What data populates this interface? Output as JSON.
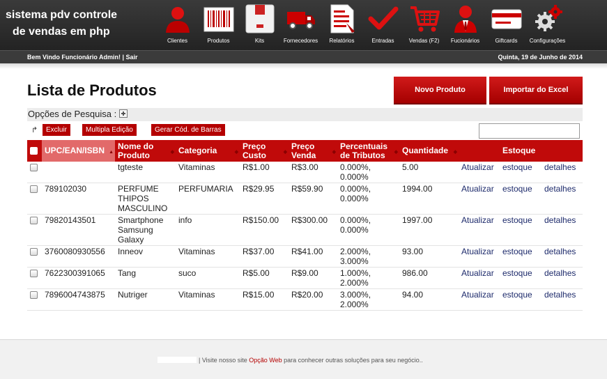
{
  "brand": {
    "line1": "sistema  pdv controle",
    "line2": "de vendas em php"
  },
  "nav": [
    {
      "label": "Clientes",
      "icon": "user-icon"
    },
    {
      "label": "Produtos",
      "icon": "barcode-icon"
    },
    {
      "label": "Kits",
      "icon": "box-icon"
    },
    {
      "label": "Fornecedores",
      "icon": "truck-icon"
    },
    {
      "label": "Relatórios",
      "icon": "report-icon"
    },
    {
      "label": "Entradas",
      "icon": "check-icon"
    },
    {
      "label": "Vendas (F2)",
      "icon": "cart-icon"
    },
    {
      "label": "Fucionários",
      "icon": "employee-icon"
    },
    {
      "label": "Giftcards",
      "icon": "giftcard-icon"
    },
    {
      "label": "Configurações",
      "icon": "gear-icon"
    }
  ],
  "welcome": {
    "text": "Bem Vindo Funcionário Admin! | Sair",
    "date": "Quinta, 19 de Junho de 2014"
  },
  "page": {
    "title": "Lista de Produtos",
    "new_product": "Novo Produto",
    "import_excel": "Importar do Excel"
  },
  "search": {
    "label": "Opções de Pesquisa :"
  },
  "actions": {
    "delete": "Excluir",
    "multi_edit": "Multipla Edição",
    "barcodes": "Gerar Cód. de Barras"
  },
  "table": {
    "headers": [
      "UPC/EAN/ISBN",
      "Nome do Produto",
      "Categoria",
      "Preço Custo",
      "Preço Venda",
      "Percentuais de Tributos",
      "Quantidade",
      "Estoque"
    ],
    "rows": [
      {
        "upc": "",
        "name": "tgteste",
        "category": "Vitaminas",
        "cost": "R$1.00",
        "price": "R$3.00",
        "taxes": "0.000%, 0.000%",
        "qty": "5.00",
        "update": "Atualizar",
        "stock": "estoque",
        "details": "detalhes"
      },
      {
        "upc": "789102030",
        "name": "PERFUME THIPOS MASCULINO",
        "category": "PERFUMARIA",
        "cost": "R$29.95",
        "price": "R$59.90",
        "taxes": "0.000%, 0.000%",
        "qty": "1994.00",
        "update": "Atualizar",
        "stock": "estoque",
        "details": "detalhes"
      },
      {
        "upc": "79820143501",
        "name": "Smartphone Samsung Galaxy",
        "category": "info",
        "cost": "R$150.00",
        "price": "R$300.00",
        "taxes": "0.000%, 0.000%",
        "qty": "1997.00",
        "update": "Atualizar",
        "stock": "estoque",
        "details": "detalhes"
      },
      {
        "upc": "3760080930556",
        "name": "Inneov",
        "category": "Vitaminas",
        "cost": "R$37.00",
        "price": "R$41.00",
        "taxes": "2.000%, 3.000%",
        "qty": "93.00",
        "update": "Atualizar",
        "stock": "estoque",
        "details": "detalhes"
      },
      {
        "upc": "7622300391065",
        "name": "Tang",
        "category": "suco",
        "cost": "R$5.00",
        "price": "R$9.00",
        "taxes": "1.000%, 2.000%",
        "qty": "986.00",
        "update": "Atualizar",
        "stock": "estoque",
        "details": "detalhes"
      },
      {
        "upc": "7896004743875",
        "name": "Nutriger",
        "category": "Vitaminas",
        "cost": "R$15.00",
        "price": "R$20.00",
        "taxes": "3.000%, 2.000%",
        "qty": "94.00",
        "update": "Atualizar",
        "stock": "estoque",
        "details": "detalhes"
      }
    ]
  },
  "footer": {
    "text": "| Visite nosso site",
    "link": "Opção Web",
    "rest": "para conhecer outras soluções para seu negócio.."
  }
}
